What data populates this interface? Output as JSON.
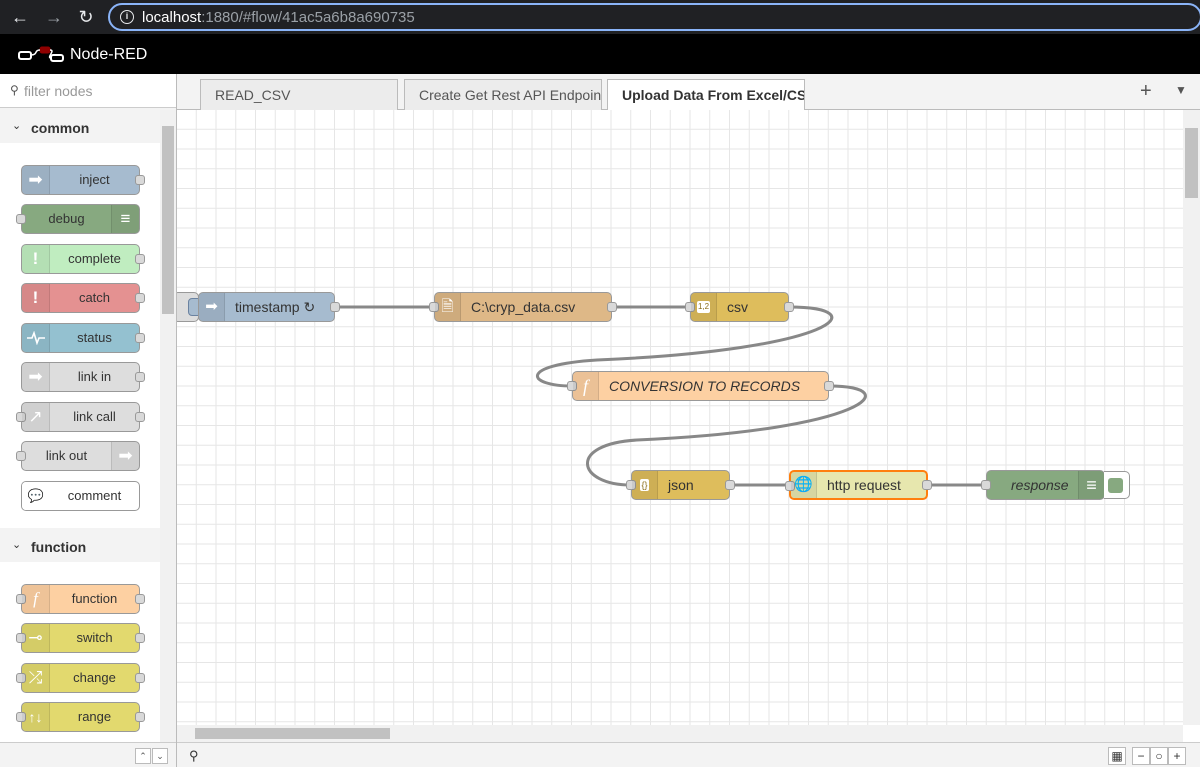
{
  "browser": {
    "url_host": "localhost",
    "url_rest": ":1880/#flow/41ac5a6b8a690735"
  },
  "app": {
    "title": "Node-RED"
  },
  "palette": {
    "filter_placeholder": "filter nodes",
    "categories": [
      {
        "label": "common",
        "nodes": [
          {
            "label": "inject",
            "color": "#a6bbcf",
            "icon": "arrow-in-icon"
          },
          {
            "label": "debug",
            "color": "#87a980",
            "icon": "list-icon"
          },
          {
            "label": "complete",
            "color": "#c0edc0",
            "icon": "exclamation-icon"
          },
          {
            "label": "catch",
            "color": "#e49191",
            "icon": "exclamation-icon"
          },
          {
            "label": "status",
            "color": "#94c1d0",
            "icon": "pulse-icon"
          },
          {
            "label": "link in",
            "color": "#dddddd",
            "icon": "link-in-icon"
          },
          {
            "label": "link call",
            "color": "#dddddd",
            "icon": "link-call-icon"
          },
          {
            "label": "link out",
            "color": "#dddddd",
            "icon": "link-out-icon"
          },
          {
            "label": "comment",
            "color": "#ffffff",
            "icon": "comment-icon"
          }
        ]
      },
      {
        "label": "function",
        "nodes": [
          {
            "label": "function",
            "color": "#fdd0a2",
            "icon": "function-icon"
          },
          {
            "label": "switch",
            "color": "#e2d96e",
            "icon": "switch-icon"
          },
          {
            "label": "change",
            "color": "#e2d96e",
            "icon": "shuffle-icon"
          },
          {
            "label": "range",
            "color": "#e2d96e",
            "icon": "range-icon"
          }
        ]
      }
    ]
  },
  "tabs": [
    {
      "label": "READ_CSV",
      "active": false
    },
    {
      "label": "Create Get Rest API Endpoint",
      "active": false
    },
    {
      "label": "Upload Data From Excel/CSV",
      "active": true
    }
  ],
  "flow": {
    "nodes": [
      {
        "id": "timestamp",
        "label": "timestamp ↻",
        "color": "#a6bbcf",
        "icon": "arrow-in-icon"
      },
      {
        "id": "file",
        "label": "C:\\cryp_data.csv",
        "color": "#deb887",
        "icon": "file-icon"
      },
      {
        "id": "csv",
        "label": "csv",
        "color": "#debd5c",
        "icon": "csv-icon",
        "icon_text": "1,2"
      },
      {
        "id": "conversion",
        "label": "CONVERSION TO RECORDS",
        "color": "#fdd0a2",
        "icon": "function-icon"
      },
      {
        "id": "json",
        "label": "json",
        "color": "#debd5c",
        "icon": "json-icon",
        "icon_text": "{}"
      },
      {
        "id": "http",
        "label": "http request",
        "color": "#e7e7ae",
        "icon": "globe-icon"
      },
      {
        "id": "response",
        "label": "response",
        "color": "#87a980",
        "icon": "list-icon"
      }
    ]
  }
}
